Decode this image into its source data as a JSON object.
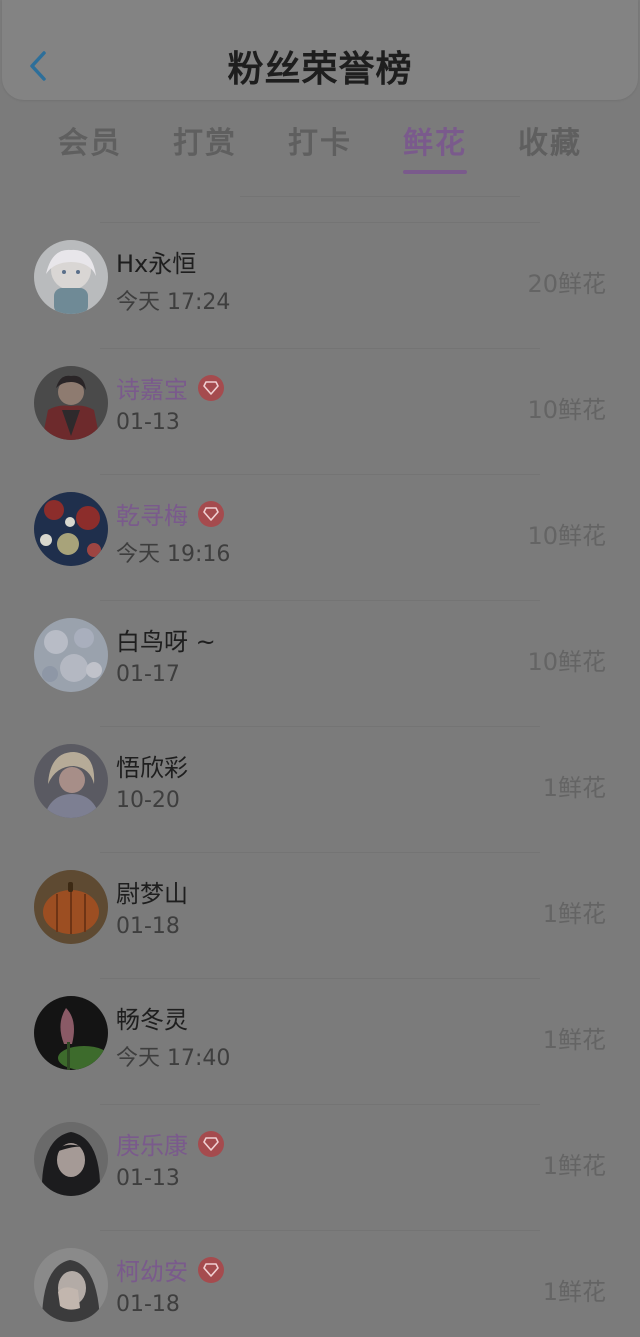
{
  "header": {
    "title": "粉丝荣誉榜",
    "back_icon": "chevron-left-icon",
    "back_color": "#2d6f9a"
  },
  "tabs": [
    {
      "label": "会员",
      "active": false
    },
    {
      "label": "打赏",
      "active": false
    },
    {
      "label": "打卡",
      "active": false
    },
    {
      "label": "鲜花",
      "active": true
    },
    {
      "label": "收藏",
      "active": false
    }
  ],
  "colors": {
    "accent": "#7a5a8c",
    "vip_badge": "#a54b4e"
  },
  "fans": [
    {
      "name": "Hx永恒",
      "time": "今天 17:24",
      "amount": "20鲜花",
      "vip": false,
      "avatar": "anime-girl-avatar"
    },
    {
      "name": "诗嘉宝",
      "time": "01-13",
      "amount": "10鲜花",
      "vip": true,
      "avatar": "caped-figure-avatar"
    },
    {
      "name": "乾寻梅",
      "time": "今天 19:16",
      "amount": "10鲜花",
      "vip": true,
      "avatar": "floral-pattern-avatar"
    },
    {
      "name": "白鸟呀 ~",
      "time": "01-17",
      "amount": "10鲜花",
      "vip": false,
      "avatar": "pastel-floral-avatar"
    },
    {
      "name": "悟欣彩",
      "time": "10-20",
      "amount": "1鲜花",
      "vip": false,
      "avatar": "blonde-girl-avatar"
    },
    {
      "name": "尉梦山",
      "time": "01-18",
      "amount": "1鲜花",
      "vip": false,
      "avatar": "pumpkin-avatar"
    },
    {
      "name": "畅冬灵",
      "time": "今天 17:40",
      "amount": "1鲜花",
      "vip": false,
      "avatar": "lotus-bud-avatar"
    },
    {
      "name": "庚乐康",
      "time": "01-13",
      "amount": "1鲜花",
      "vip": true,
      "avatar": "dark-hair-girl-avatar"
    },
    {
      "name": "柯幼安",
      "time": "01-18",
      "amount": "1鲜花",
      "vip": true,
      "avatar": "hand-over-face-avatar"
    }
  ]
}
